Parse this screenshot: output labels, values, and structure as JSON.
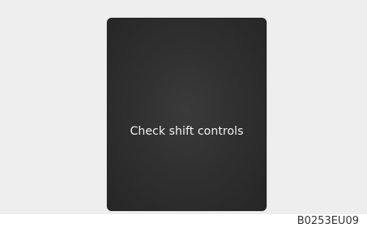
{
  "display": {
    "message": "Check shift controls"
  },
  "figure": {
    "code": "B0253EU09"
  }
}
